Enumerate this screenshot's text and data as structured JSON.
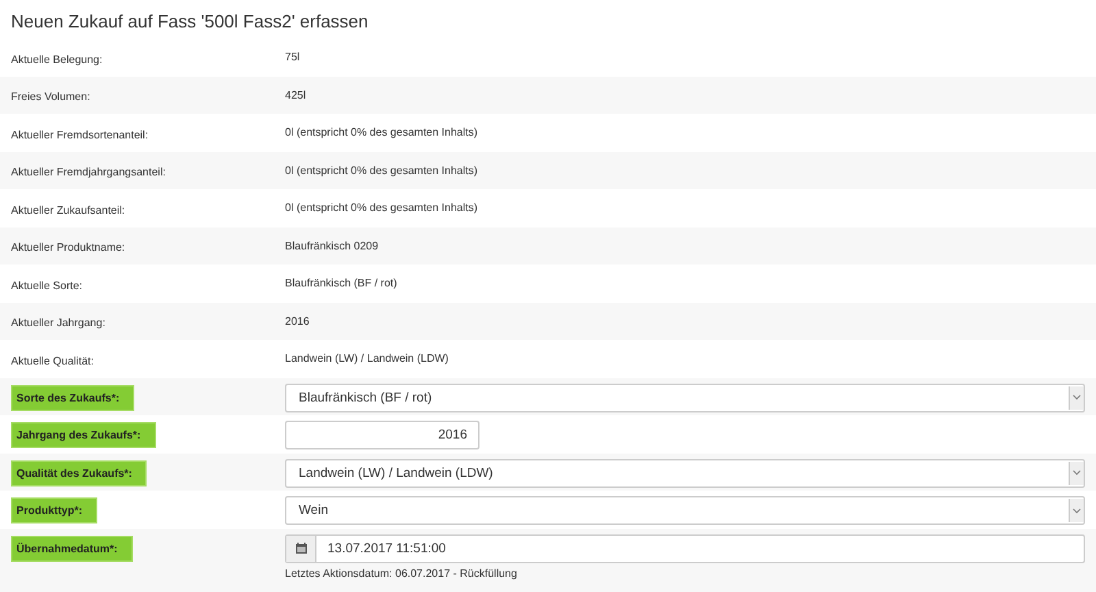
{
  "title": "Neuen Zukauf auf Fass '500l Fass2' erfassen",
  "info_rows": [
    {
      "label": "Aktuelle Belegung:",
      "value": "75l"
    },
    {
      "label": "Freies Volumen:",
      "value": "425l"
    },
    {
      "label": "Aktueller Fremdsortenanteil:",
      "value": "0l (entspricht 0% des gesamten Inhalts)"
    },
    {
      "label": "Aktueller Fremdjahrgangsanteil:",
      "value": "0l (entspricht 0% des gesamten Inhalts)"
    },
    {
      "label": "Aktueller Zukaufsanteil:",
      "value": "0l (entspricht 0% des gesamten Inhalts)"
    },
    {
      "label": "Aktueller Produktname:",
      "value": "Blaufränkisch 0209"
    },
    {
      "label": "Aktuelle Sorte:",
      "value": "Blaufränkisch (BF / rot)"
    },
    {
      "label": "Aktueller Jahrgang:",
      "value": "2016"
    },
    {
      "label": "Aktuelle Qualität:",
      "value": "Landwein (LW) / Landwein (LDW)"
    }
  ],
  "form_rows": [
    {
      "kind": "select",
      "label": "Sorte des Zukaufs*:",
      "value": "Blaufränkisch (BF / rot)"
    },
    {
      "kind": "number",
      "label": "Jahrgang des Zukaufs*:",
      "value": "2016"
    },
    {
      "kind": "select",
      "label": "Qualität des Zukaufs*:",
      "value": "Landwein (LW) / Landwein (LDW)"
    },
    {
      "kind": "select",
      "label": "Produkttyp*:",
      "value": "Wein"
    },
    {
      "kind": "date",
      "label": "Übernahmedatum*:",
      "value": "13.07.2017 11:51:00",
      "help": "Letztes Aktionsdatum: 06.07.2017 - Rückfüllung"
    }
  ]
}
